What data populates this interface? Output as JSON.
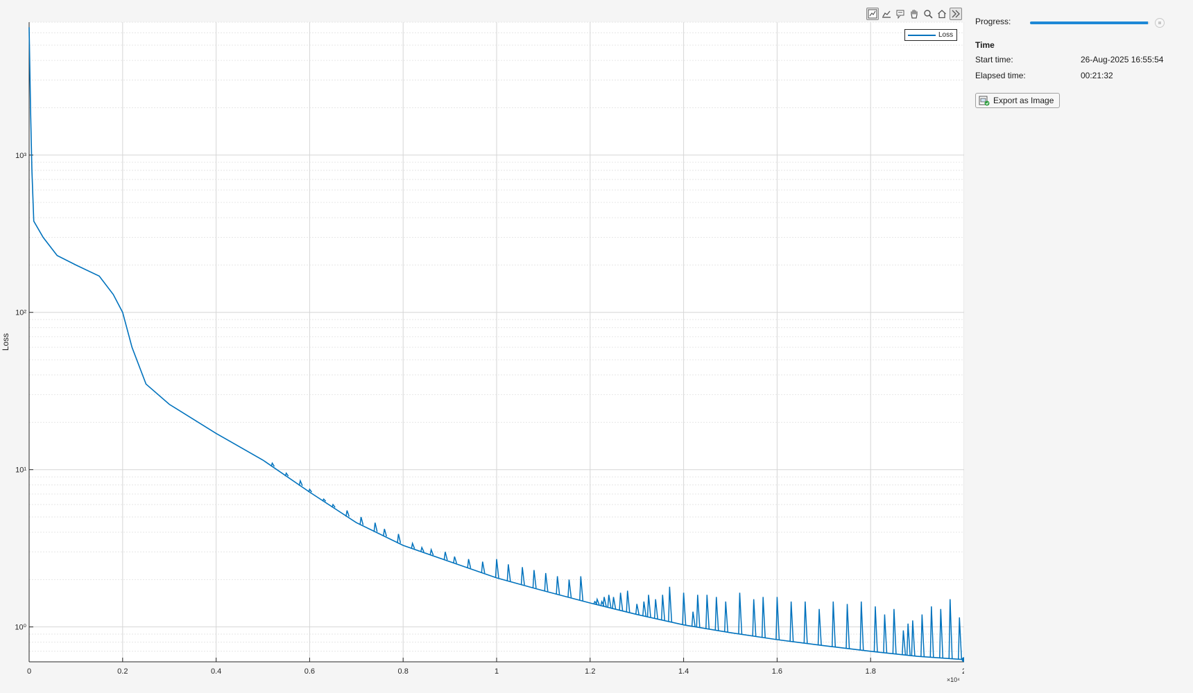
{
  "toolbar": {
    "icons": [
      "data-tips-icon",
      "brush-icon",
      "datatip-cursor-icon",
      "pan-hand-icon",
      "zoom-icon",
      "home-icon",
      "expand-icon"
    ]
  },
  "panel": {
    "progress_label": "Progress:",
    "progress_fraction": 0.99,
    "time_heading": "Time",
    "start_label": "Start time:",
    "start_value": "26-Aug-2025 16:55:54",
    "elapsed_label": "Elapsed time:",
    "elapsed_value": "00:21:32",
    "export_label": "Export as Image"
  },
  "colors": {
    "line": "#0072bd",
    "progress": "#1e88d6",
    "grid": "#d6d6d6"
  },
  "chart_data": {
    "type": "line",
    "ylabel": "Loss",
    "xlabel": "",
    "x_exponent_label": "×10⁴",
    "xlim": [
      0,
      20000
    ],
    "ylim": [
      0.6,
      7000
    ],
    "yscale": "log",
    "grid": true,
    "legend_position": "top-right",
    "x_ticks": [
      0,
      2000,
      4000,
      6000,
      8000,
      10000,
      12000,
      14000,
      16000,
      18000,
      20000
    ],
    "x_tick_labels": [
      "0",
      "0.2",
      "0.4",
      "0.6",
      "0.8",
      "1",
      "1.2",
      "1.4",
      "1.6",
      "1.8",
      "2"
    ],
    "y_ticks": [
      1,
      10,
      100,
      1000
    ],
    "y_tick_labels": [
      "10⁰",
      "10¹",
      "10²",
      "10³"
    ],
    "series": [
      {
        "name": "Loss",
        "x": [
          0,
          30,
          60,
          100,
          300,
          600,
          1000,
          1500,
          1800,
          2000,
          2200,
          2500,
          3000,
          4000,
          5000,
          6000,
          7000,
          8000,
          9000,
          10000,
          11000,
          12000,
          13000,
          14000,
          15000,
          16000,
          17000,
          18000,
          19000,
          20000
        ],
        "y": [
          6500,
          2000,
          800,
          380,
          300,
          230,
          200,
          170,
          130,
          100,
          60,
          35,
          26,
          17,
          11.5,
          7.2,
          4.6,
          3.3,
          2.6,
          2.05,
          1.7,
          1.42,
          1.2,
          1.03,
          0.92,
          0.83,
          0.76,
          0.7,
          0.65,
          0.62
        ]
      }
    ],
    "spikes": {
      "x": [
        5200,
        5500,
        5800,
        6000,
        6300,
        6500,
        6800,
        7100,
        7400,
        7600,
        7900,
        8200,
        8400,
        8600,
        8900,
        9100,
        9400,
        9700,
        10000,
        10250,
        10550,
        10800,
        11050,
        11300,
        11550,
        11800,
        12100,
        12150,
        12250,
        12300,
        12400,
        12500,
        12650,
        12800,
        13000,
        13150,
        13250,
        13400,
        13550,
        13700,
        14000,
        14200,
        14300,
        14500,
        14700,
        14900,
        15200,
        15500,
        15700,
        16000,
        16300,
        16600,
        16900,
        17200,
        17500,
        17800,
        18100,
        18300,
        18500,
        18700,
        18800,
        18900,
        19100,
        19300,
        19500,
        19700,
        19900
      ],
      "peak": [
        11,
        9.5,
        8.5,
        7.5,
        6.5,
        6.0,
        5.5,
        5.0,
        4.6,
        4.2,
        3.9,
        3.4,
        3.2,
        3.1,
        3.0,
        2.8,
        2.7,
        2.6,
        2.7,
        2.5,
        2.4,
        2.3,
        2.2,
        2.1,
        2.0,
        2.1,
        1.45,
        1.5,
        1.45,
        1.55,
        1.6,
        1.55,
        1.65,
        1.7,
        1.4,
        1.45,
        1.6,
        1.5,
        1.6,
        1.8,
        1.65,
        1.25,
        1.6,
        1.6,
        1.55,
        1.45,
        1.65,
        1.5,
        1.55,
        1.55,
        1.45,
        1.45,
        1.3,
        1.45,
        1.4,
        1.45,
        1.35,
        1.2,
        1.3,
        0.95,
        1.05,
        1.1,
        1.2,
        1.35,
        1.3,
        1.5,
        1.15
      ]
    }
  }
}
